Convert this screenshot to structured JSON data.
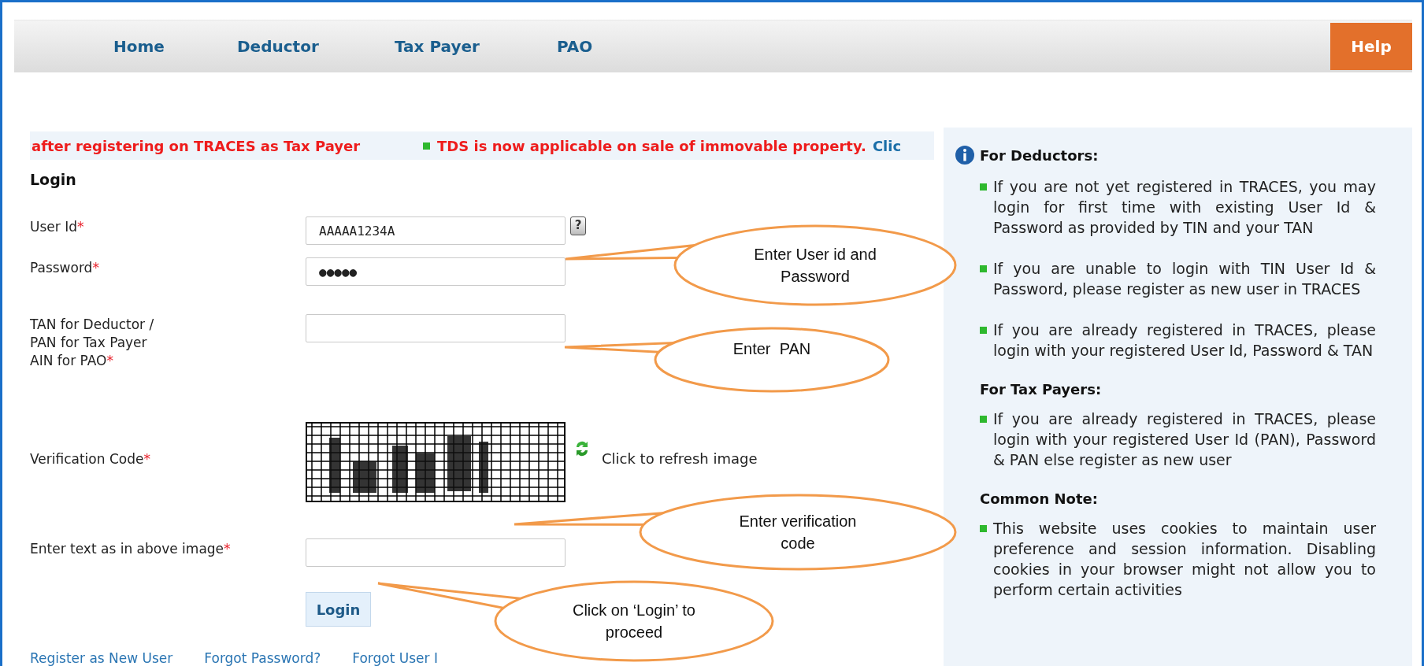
{
  "nav": {
    "items": [
      {
        "label": "Home",
        "selected": false
      },
      {
        "label": "Deductor",
        "selected": false
      },
      {
        "label": "Tax Payer",
        "selected": false
      },
      {
        "label": "PAO",
        "selected": false
      }
    ],
    "help": "Help"
  },
  "ticker": [
    {
      "kind": "alert",
      "text": "after registering on TRACES as Tax Payer"
    },
    {
      "kind": "bulleted-alert",
      "text": "TDS is now applicable on sale of immovable property."
    },
    {
      "kind": "link",
      "text": "Clic"
    }
  ],
  "login": {
    "title": "Login",
    "fields": [
      {
        "kind": "input",
        "label_lines": [
          "User Id"
        ],
        "mark": "*",
        "value": "AAAAA1234A",
        "help_glyph": "?"
      },
      {
        "kind": "input",
        "label_lines": [
          "Password"
        ],
        "mark": "*",
        "value": "●●●●●"
      },
      {
        "kind": "input",
        "label_lines": [
          "TAN for Deductor /",
          "PAN for Tax Payer",
          "AIN for PAO"
        ],
        "mark": "*"
      },
      {
        "kind": "captcha",
        "label_lines": [
          "Verification Code"
        ],
        "mark": "*",
        "refresh": "Click to refresh image"
      },
      {
        "kind": "input",
        "label_lines": [
          "Enter text as in above image"
        ],
        "mark": "*"
      }
    ],
    "button": "Login",
    "links": [
      "Register as New User",
      "Forgot Password?",
      "Forgot User I"
    ]
  },
  "info": {
    "sections": [
      {
        "title": "For Deductors:",
        "icon": true,
        "items": [
          "If you are not yet registered in TRACES, you may login for first time with existing User Id & Password as provided by TIN and your TAN",
          "If you are unable to login with TIN User Id & Password, please register as new user in TRACES",
          "If you are already registered in TRACES, please login with your registered User Id, Password & TAN"
        ]
      },
      {
        "title": "For Tax Payers:",
        "icon": false,
        "items": [
          "If you are already registered in TRACES, please login with your registered User Id (PAN), Password & PAN else register as new user"
        ]
      },
      {
        "title": "Common Note:",
        "icon": false,
        "items": [
          "This website uses cookies to maintain user preference and session information. Disabling cookies in your browser might not allow you to perform certain activities"
        ]
      }
    ]
  },
  "callouts": [
    {
      "text": "Enter User id and Password"
    },
    {
      "text": "Enter  PAN"
    },
    {
      "text": "Enter verification code"
    },
    {
      "text": "Click on ‘Login’ to proceed"
    }
  ]
}
